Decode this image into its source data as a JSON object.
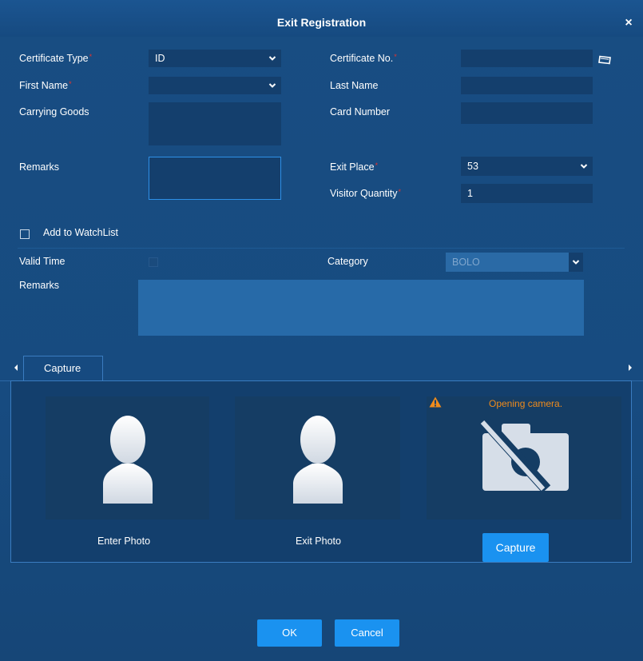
{
  "dialog": {
    "title": "Exit Registration",
    "close_symbol": "×"
  },
  "form": {
    "certificate_type": {
      "label": "Certificate Type",
      "value": "ID"
    },
    "certificate_no": {
      "label": "Certificate No.",
      "value": ""
    },
    "first_name": {
      "label": "First Name",
      "value": ""
    },
    "last_name": {
      "label": "Last Name",
      "value": ""
    },
    "carrying_goods": {
      "label": "Carrying Goods",
      "value": ""
    },
    "card_number": {
      "label": "Card Number",
      "value": ""
    },
    "remarks": {
      "label": "Remarks",
      "value": ""
    },
    "exit_place": {
      "label": "Exit Place",
      "value": "53"
    },
    "visitor_quantity": {
      "label": "Visitor Quantity",
      "value": "1"
    }
  },
  "watchlist": {
    "add_label": "Add to WatchList",
    "checked": false,
    "valid_time_label": "Valid Time",
    "category_label": "Category",
    "category_value": "BOLO",
    "remarks_label": "Remarks",
    "remarks_value": ""
  },
  "capture": {
    "tab_label": "Capture",
    "enter_photo_label": "Enter Photo",
    "exit_photo_label": "Exit Photo",
    "camera_status": "Opening camera.",
    "capture_button": "Capture"
  },
  "footer": {
    "ok_label": "OK",
    "cancel_label": "Cancel"
  },
  "colors": {
    "accent": "#1a92f0",
    "required": "#e8332d",
    "warning": "#ef8b1c",
    "background": "#174b80",
    "field": "#143f6d"
  },
  "icons": [
    "close-icon",
    "chevron-down-icon",
    "card-reader-icon",
    "person-silhouette-icon",
    "camera-off-icon",
    "warning-icon",
    "scroll-left-icon",
    "scroll-right-icon"
  ]
}
